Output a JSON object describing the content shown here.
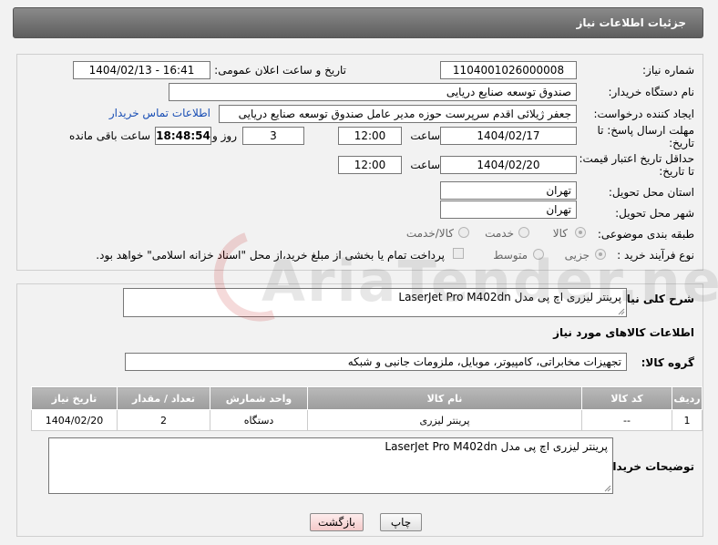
{
  "header": {
    "title": "جزئیات اطلاعات نیاز"
  },
  "form": {
    "need_number": {
      "label": "شماره نیاز:",
      "value": "1104001026000008"
    },
    "announce_datetime": {
      "label": "تاریخ و ساعت اعلان عمومی:",
      "value": "1404/02/13 - 16:41"
    },
    "buyer_org": {
      "label": "نام دستگاه خریدار:",
      "value": "صندوق توسعه صنایع دریایی"
    },
    "requester": {
      "label": "ایجاد کننده درخواست:",
      "value": "جعفر ژیلائی اقدم سرپرست حوزه مدیر عامل صندوق توسعه صنایع دریایی",
      "contact_link": "اطلاعات تماس خریدار"
    },
    "reply_deadline": {
      "label_line1": "مهلت ارسال پاسخ: تا",
      "label_line2": "تاریخ:",
      "date": "1404/02/17",
      "time_label": "ساعت",
      "time": "12:00",
      "days": "3",
      "days_label": "روز و",
      "remaining": "18:48:54",
      "remaining_label": "ساعت باقی مانده"
    },
    "price_validity": {
      "label_line1": "حداقل تاریخ اعتبار قیمت:",
      "label_line2": "تا تاریخ:",
      "date": "1404/02/20",
      "time_label": "ساعت",
      "time": "12:00"
    },
    "delivery_province": {
      "label": "استان محل تحویل:",
      "value": "تهران"
    },
    "delivery_city": {
      "label": "شهر محل تحویل:",
      "value": "تهران"
    },
    "category": {
      "label": "طبقه بندی موضوعی:",
      "options": [
        "کالا",
        "خدمت",
        "کالا/خدمت"
      ],
      "selected": "کالا"
    },
    "purchase_process": {
      "label": "نوع فرآیند خرید :",
      "options": [
        "جزیی",
        "متوسط"
      ],
      "selected": "جزیی",
      "payment_note": "پرداخت تمام یا بخشی از مبلغ خرید،از محل \"اسناد خزانه اسلامی\" خواهد بود."
    }
  },
  "description": {
    "label": "شرح کلی نیاز:",
    "value": "پرینتر لیزری اچ پی مدل LaserJet Pro M402dn"
  },
  "goods_info": {
    "title": "اطلاعات کالاهای مورد نیاز"
  },
  "goods_group": {
    "label": "گروه کالا:",
    "value": "تجهیزات مخابراتی، کامپیوتر، موبایل، ملزومات جانبی و شبکه"
  },
  "table": {
    "headers": [
      "ردیف",
      "کد کالا",
      "نام کالا",
      "واحد شمارش",
      "تعداد / مقدار",
      "تاریخ نیاز"
    ],
    "rows": [
      {
        "row": "1",
        "code": "--",
        "name": "پرینتر لیزری",
        "unit": "دستگاه",
        "qty": "2",
        "date": "1404/02/20"
      }
    ]
  },
  "buyer_notes": {
    "label": "توضیحات خریدار:",
    "value": "پرینتر لیزری اچ پی مدل LaserJet Pro M402dn"
  },
  "buttons": {
    "print": "چاپ",
    "back": "بازگشت"
  },
  "watermark": {
    "text": "AriaTender.neT"
  }
}
